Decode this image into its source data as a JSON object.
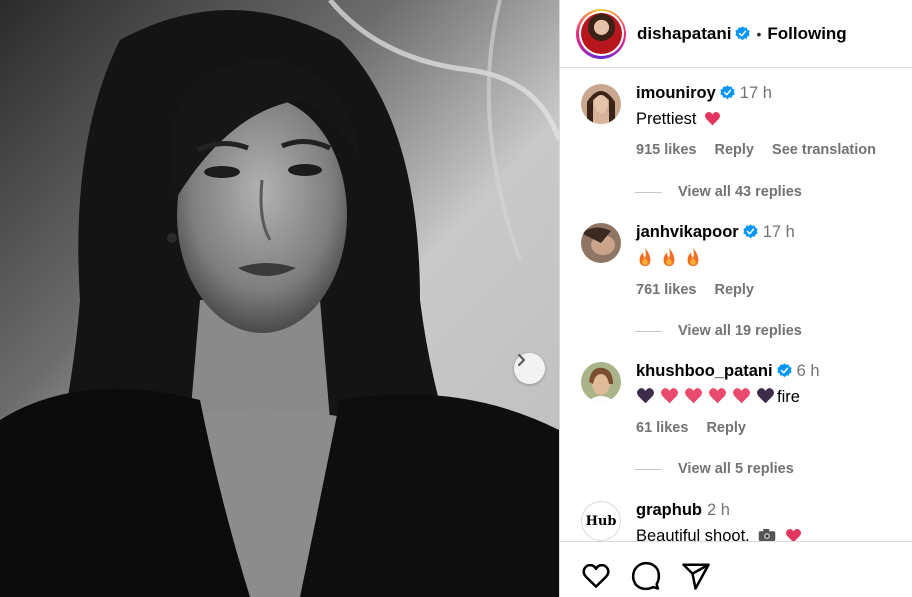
{
  "post": {
    "author": "dishapatani",
    "follow_status": "Following",
    "separator": "•"
  },
  "comments": [
    {
      "username": "imouniroy",
      "time": "17 h",
      "text": "Prettiest",
      "likes": "915 likes",
      "reply": "Reply",
      "translate": "See translation",
      "view_replies": "View all 43 replies"
    },
    {
      "username": "janhvikapoor",
      "time": "17 h",
      "text": "",
      "likes": "761 likes",
      "reply": "Reply",
      "view_replies": "View all 19 replies"
    },
    {
      "username": "khushboo_patani",
      "time": "6 h",
      "text": "fire",
      "likes": "61 likes",
      "reply": "Reply",
      "view_replies": "View all 5 replies"
    },
    {
      "username": "graphub",
      "time": "2 h",
      "text": "Beautiful shoot.",
      "avatar_text": "Hub"
    }
  ],
  "colors": {
    "verified": "#0095f6",
    "muted": "#737373",
    "heart": "#ec4a6e",
    "border": "#dbdbdb"
  },
  "icons": [
    "chevron-right-icon",
    "verified-badge-icon",
    "heart-icon",
    "comment-icon",
    "share-icon",
    "camera-icon",
    "fire-icon"
  ]
}
